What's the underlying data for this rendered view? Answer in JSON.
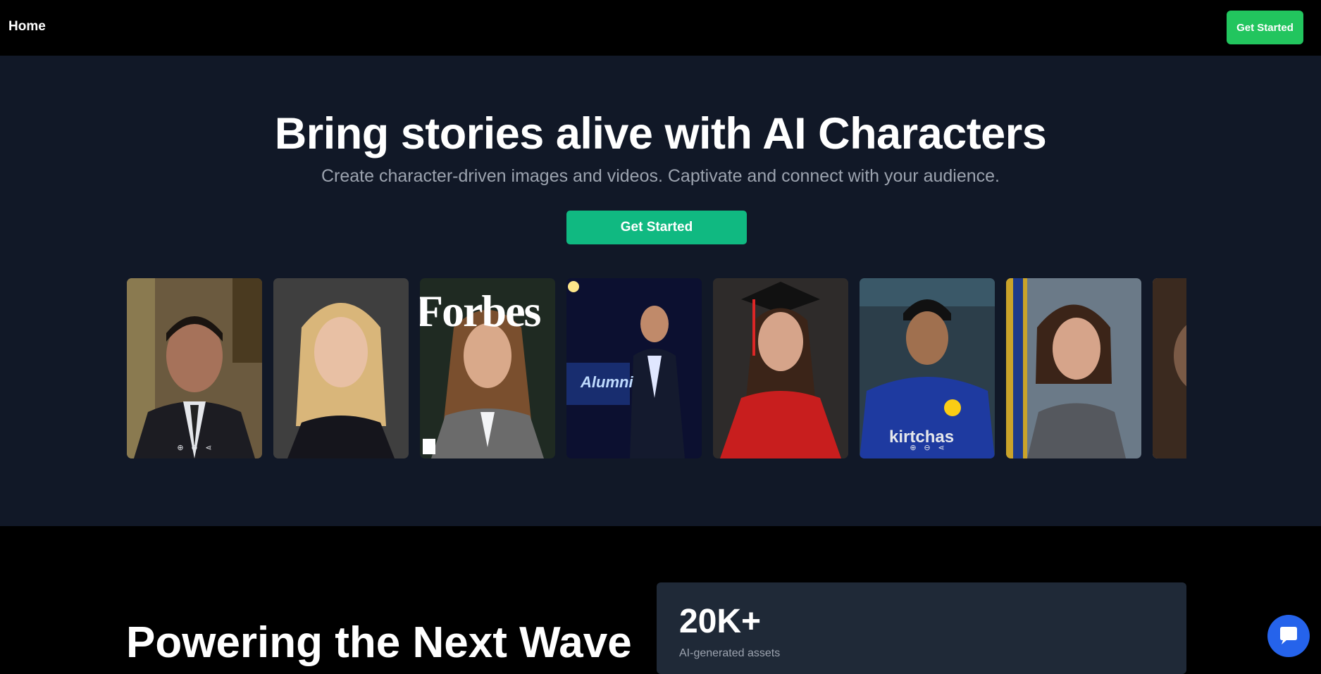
{
  "nav": {
    "home_label": "Home",
    "cta_label": "Get Started"
  },
  "hero": {
    "title": "Bring stories alive with AI Characters",
    "subtitle": "Create character-driven images and videos. Captivate and connect with your audience.",
    "cta_label": "Get Started"
  },
  "gallery": {
    "cover_masthead": "Forbes",
    "stage_text": "Alumni",
    "jersey_text": "kirtchas"
  },
  "section2": {
    "heading": "Powering the Next Wave",
    "stat_value": "20K+",
    "stat_label": "AI-generated assets"
  },
  "icons": {
    "zoom_in": "zoom-in-icon",
    "zoom_out": "zoom-out-icon",
    "share": "share-icon",
    "chat": "chat-icon"
  },
  "colors": {
    "nav_cta": "#22c55e",
    "hero_cta": "#10b981",
    "hero_bg": "#111827",
    "stat_bg": "#1f2937",
    "chat": "#2563eb"
  }
}
